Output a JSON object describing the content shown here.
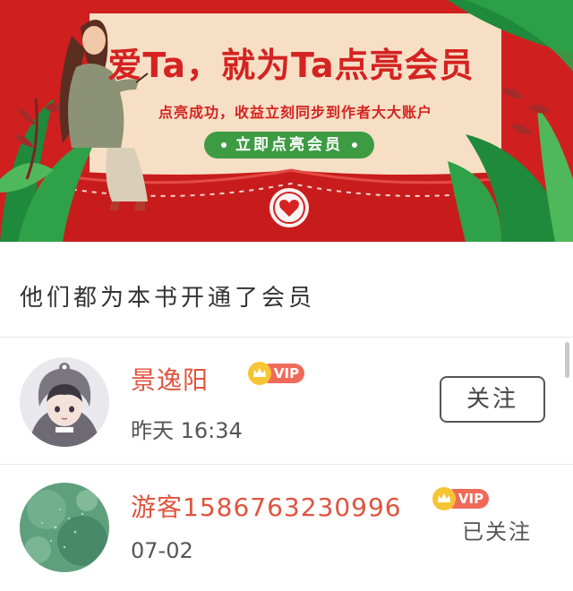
{
  "banner": {
    "title": "爱Ta，就为Ta点亮会员",
    "subtitle": "点亮成功，收益立刻同步到作者大大账户",
    "button_label": "立即点亮会员",
    "colors": {
      "background": "#d01f1f",
      "envelope": "#f7dfc6",
      "button": "#3d9b43",
      "title": "#d42321"
    }
  },
  "section": {
    "title": "他们都为本书开通了会员"
  },
  "members": [
    {
      "name": "景逸阳",
      "badge": "VIP",
      "time": "昨天 16:34",
      "action": "关注",
      "avatar": "anime-hooded-boy-avatar"
    },
    {
      "name": "游客1586763230996",
      "badge": "VIP",
      "time": "07-02",
      "action": "已关注",
      "avatar": "green-leaves-avatar"
    }
  ]
}
